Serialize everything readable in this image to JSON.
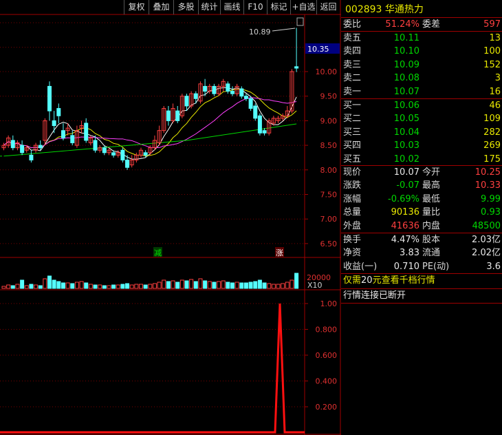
{
  "toolbar": {
    "buttons": [
      "复权",
      "叠加",
      "多股",
      "统计",
      "画线",
      "F10",
      "标记",
      "+自选",
      "返回"
    ]
  },
  "stock": {
    "code": "002893",
    "name": "华通热力"
  },
  "main_chart": {
    "price_axis": [
      "10.00",
      "9.50",
      "9.00",
      "8.50",
      "8.00",
      "7.50",
      "7.00",
      "6.50"
    ],
    "current_price_tag": "10.35",
    "high_annotation": "10.89",
    "markers": [
      "减",
      "涨"
    ]
  },
  "volume_chart": {
    "axis_label": "20000",
    "unit": "X10"
  },
  "indicator_chart": {
    "axis": [
      "1.00",
      "0.800",
      "0.600",
      "0.400",
      "0.200"
    ]
  },
  "quote": {
    "ratio": {
      "label": "委比",
      "value": "51.24%",
      "label2": "委差",
      "value2": "597"
    },
    "asks": [
      {
        "label": "卖五",
        "price": "10.11",
        "vol": "13"
      },
      {
        "label": "卖四",
        "price": "10.10",
        "vol": "100"
      },
      {
        "label": "卖三",
        "price": "10.09",
        "vol": "152"
      },
      {
        "label": "卖二",
        "price": "10.08",
        "vol": "3"
      },
      {
        "label": "卖一",
        "price": "10.07",
        "vol": "16"
      }
    ],
    "bids": [
      {
        "label": "买一",
        "price": "10.06",
        "vol": "46"
      },
      {
        "label": "买二",
        "price": "10.05",
        "vol": "109"
      },
      {
        "label": "买三",
        "price": "10.04",
        "vol": "282"
      },
      {
        "label": "买四",
        "price": "10.03",
        "vol": "269"
      },
      {
        "label": "买五",
        "price": "10.02",
        "vol": "175"
      }
    ],
    "stats": [
      {
        "l1": "现价",
        "v1": "10.07",
        "l2": "今开",
        "v2": "10.25"
      },
      {
        "l1": "涨跌",
        "v1": "-0.07",
        "l2": "最高",
        "v2": "10.33"
      },
      {
        "l1": "涨幅",
        "v1": "-0.69%",
        "l2": "最低",
        "v2": "9.99"
      },
      {
        "l1": "总量",
        "v1": "90136",
        "l2": "量比",
        "v2": "0.93"
      },
      {
        "l1": "外盘",
        "v1": "41636",
        "l2": "内盘",
        "v2": "48500"
      }
    ],
    "fund": [
      {
        "l1": "换手",
        "v1": "4.47%",
        "l2": "股本",
        "v2": "2.03亿"
      },
      {
        "l1": "净资",
        "v1": "3.83",
        "l2": "流通",
        "v2": "2.02亿"
      },
      {
        "l1": "收益(一)",
        "v1": "0.710",
        "l2": "PE(动)",
        "v2": "3.6"
      }
    ],
    "notice_pre": "仅需",
    "notice_num": "20",
    "notice_post": "元查看千档行情",
    "status": "行情连接已断开"
  },
  "colors": {
    "up": "#ff4040",
    "down": "#00d800",
    "border": "#a00000",
    "ma5": "#ffffff",
    "ma10": "#e8e800",
    "ma20": "#ff40ff",
    "ma60": "#00d800"
  }
}
